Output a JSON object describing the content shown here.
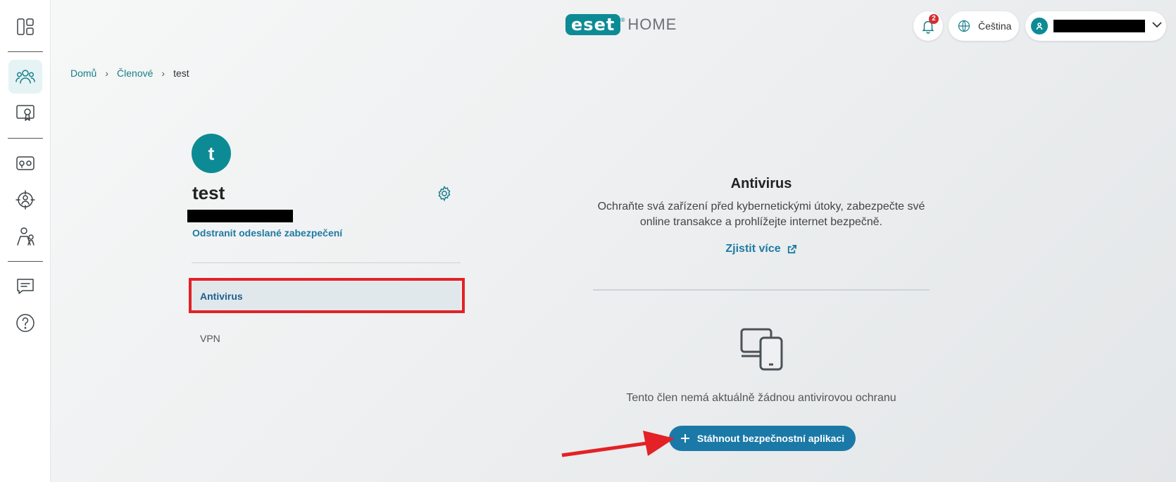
{
  "header": {
    "logo_badge": "eset",
    "logo_registered": "®",
    "logo_suffix": "HOME",
    "notification_count": "2",
    "language": "Čeština"
  },
  "breadcrumb": {
    "home": "Domů",
    "members": "Členové",
    "current": "test"
  },
  "member": {
    "initial": "t",
    "name": "test",
    "remove_link": "Odstranit odeslané zabezpečení",
    "products": [
      {
        "label": "Antivirus",
        "selected": true
      },
      {
        "label": "VPN",
        "selected": false
      }
    ]
  },
  "product_detail": {
    "title": "Antivirus",
    "description": "Ochraňte svá zařízení před kybernetickými útoky, zabezpečte své online transakce a prohlížejte internet bezpečně.",
    "learn_more": "Zjistit více",
    "no_protection": "Tento člen nemá aktuálně žádnou antivirovou ochranu",
    "download_button": "Stáhnout bezpečnostní aplikaci"
  },
  "colors": {
    "accent": "#0d8b95",
    "link": "#1f7aa3",
    "button": "#1b79a8",
    "annotation": "#e32126"
  },
  "icons": [
    "dashboard-icon",
    "members-icon",
    "license-icon",
    "password-manager-icon",
    "anti-theft-icon",
    "parental-control-icon",
    "messages-icon",
    "help-icon",
    "bell-icon",
    "globe-icon",
    "user-icon",
    "chevron-down-icon",
    "gear-icon",
    "external-link-icon",
    "devices-icon",
    "plus-icon"
  ]
}
